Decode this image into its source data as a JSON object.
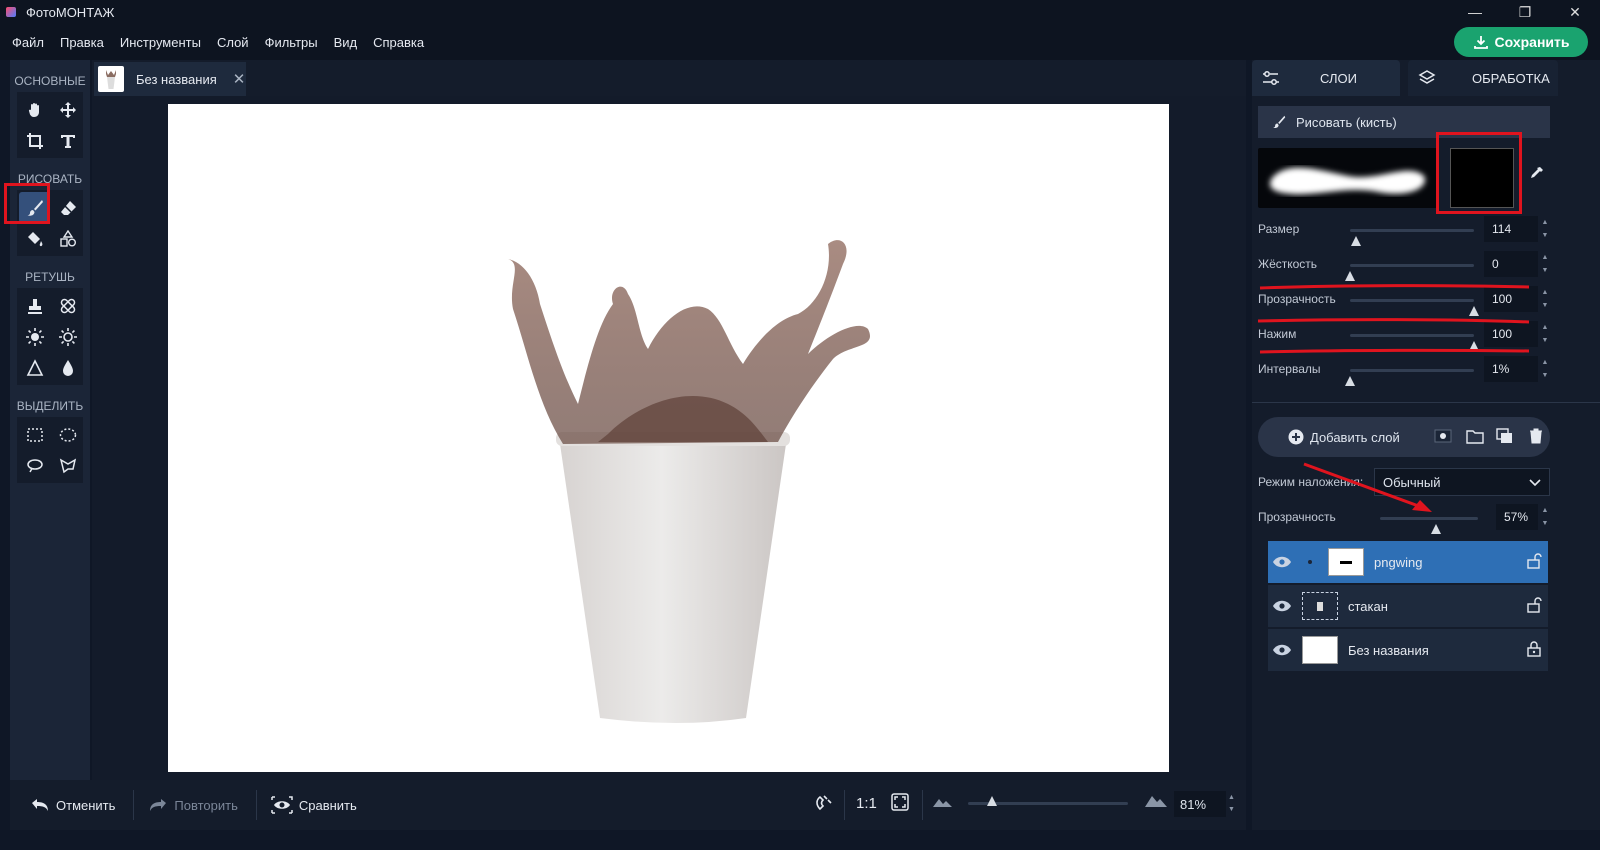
{
  "window": {
    "title": "ФотоМОНТАЖ",
    "minimize": "—",
    "maximize": "❐",
    "close": "✕"
  },
  "menu": [
    "Файл",
    "Правка",
    "Инструменты",
    "Слой",
    "Фильтры",
    "Вид",
    "Справка"
  ],
  "save_label": "Сохранить",
  "tools": {
    "sections": [
      "ОСНОВНЫЕ",
      "РИСОВАТЬ",
      "РЕТУШЬ",
      "ВЫДЕЛИТЬ"
    ],
    "active": "brush-tool"
  },
  "document_tab": {
    "name": "Без названия",
    "close": "✕"
  },
  "bottom": {
    "undo": "Отменить",
    "redo": "Повторить",
    "compare": "Сравнить",
    "one_to_one": "1:1",
    "zoom_value": "81%",
    "zoom_fraction": 0.04
  },
  "right_panel": {
    "tabs": [
      "СЛОИ",
      "ОБРАБОТКА"
    ],
    "tool_header": "Рисовать (кисть)",
    "brush_color": "#000000",
    "params": [
      {
        "label": "Размер",
        "value": "114",
        "fraction": 0.05
      },
      {
        "label": "Жёсткость",
        "value": "0",
        "fraction": 0.0
      },
      {
        "label": "Прозрачность",
        "value": "100",
        "fraction": 1.0
      },
      {
        "label": "Нажим",
        "value": "100",
        "fraction": 1.0
      },
      {
        "label": "Интервалы",
        "value": "1%",
        "fraction": 0.0
      }
    ],
    "add_layer": "Добавить слой",
    "blend_label": "Режим наложения:",
    "blend_value": "Обычный",
    "opacity_label": "Прозрачность",
    "opacity_value": "57%",
    "opacity_fraction": 0.57,
    "layers": [
      {
        "name": "pngwing",
        "selected": true
      },
      {
        "name": "стакан",
        "selected": false
      },
      {
        "name": "Без названия",
        "selected": false
      }
    ]
  },
  "colors": {
    "accent_green": "#1aa36f",
    "selected_layer": "#2e6fb5",
    "highlight_red": "#e0141e"
  }
}
